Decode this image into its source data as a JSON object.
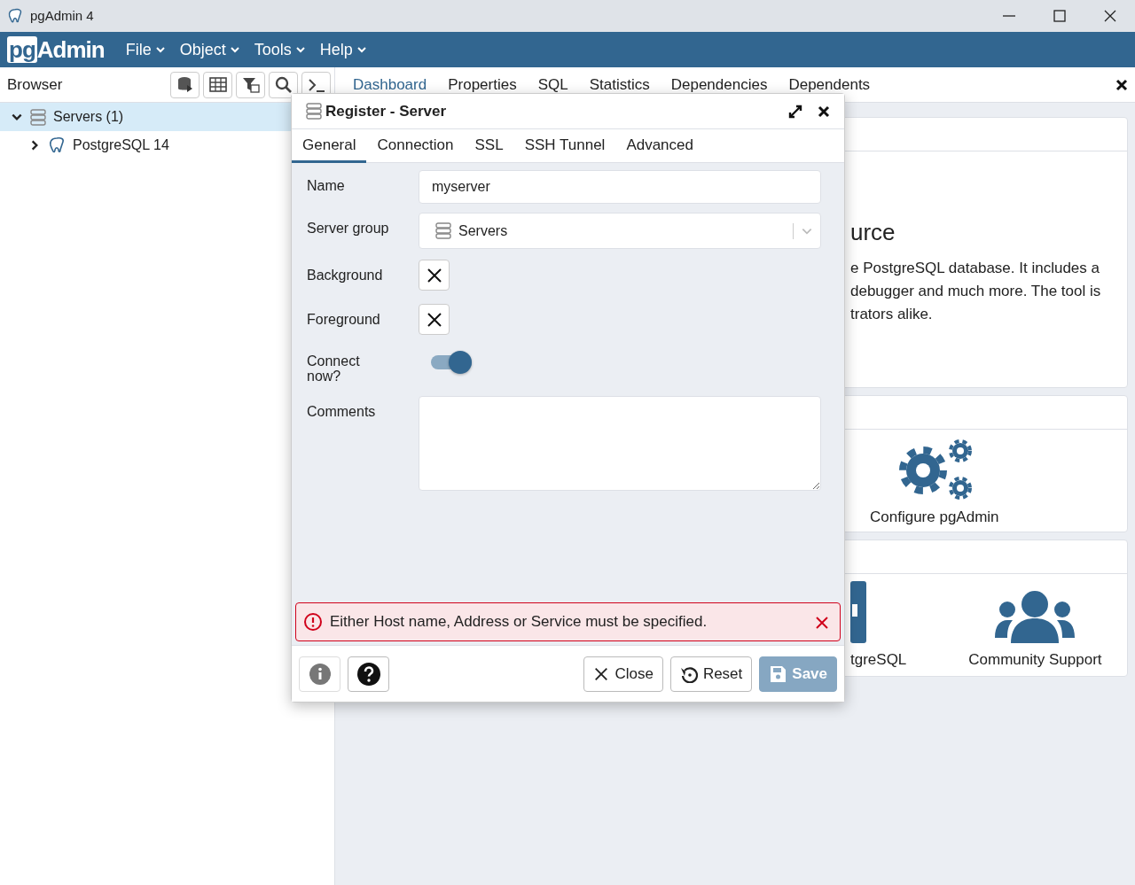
{
  "window": {
    "title": "pgAdmin 4"
  },
  "logo": {
    "prefix": "pg",
    "name": "Admin"
  },
  "menu": [
    {
      "label": "File"
    },
    {
      "label": "Object"
    },
    {
      "label": "Tools"
    },
    {
      "label": "Help"
    }
  ],
  "browser": {
    "title": "Browser",
    "tree": [
      {
        "label": "Servers (1)",
        "expanded": true,
        "selected": true,
        "children": [
          {
            "label": "PostgreSQL 14",
            "expanded": false,
            "selected": false
          }
        ]
      }
    ]
  },
  "tabs": [
    {
      "label": "Dashboard",
      "selected": true
    },
    {
      "label": "Properties",
      "selected": false
    },
    {
      "label": "SQL",
      "selected": false
    },
    {
      "label": "Statistics",
      "selected": false
    },
    {
      "label": "Dependencies",
      "selected": false
    },
    {
      "label": "Dependents",
      "selected": false
    }
  ],
  "dashboard": {
    "heading": "urce",
    "lines": [
      "e PostgreSQL database. It includes a",
      "debugger and much more. The tool is",
      "trators alike."
    ],
    "links": [
      {
        "kind": "gears",
        "label": "Configure pgAdmin"
      },
      {
        "kind": "doc",
        "label": "tgreSQL"
      },
      {
        "kind": "people",
        "label": "Community Support"
      }
    ]
  },
  "dialog": {
    "title": "Register - Server",
    "tabs": [
      {
        "label": "General",
        "selected": true
      },
      {
        "label": "Connection",
        "selected": false
      },
      {
        "label": "SSL",
        "selected": false
      },
      {
        "label": "SSH Tunnel",
        "selected": false
      },
      {
        "label": "Advanced",
        "selected": false
      }
    ],
    "fields": [
      {
        "kind": "text",
        "label": "Name",
        "value": "myserver"
      },
      {
        "kind": "select",
        "label": "Server group",
        "value": "Servers"
      },
      {
        "kind": "color",
        "label": "Background"
      },
      {
        "kind": "color",
        "label": "Foreground"
      },
      {
        "kind": "switch",
        "label": "Connect now?",
        "on": true
      },
      {
        "kind": "textarea",
        "label": "Comments"
      }
    ],
    "error": "Either Host name, Address or Service must be specified.",
    "buttons": [
      {
        "kind": "info",
        "disabled": false
      },
      {
        "kind": "help",
        "disabled": false
      },
      {
        "kind": "close",
        "label": "Close",
        "disabled": false
      },
      {
        "kind": "reset",
        "label": "Reset",
        "disabled": false
      },
      {
        "kind": "save",
        "label": "Save",
        "disabled": true
      }
    ]
  }
}
